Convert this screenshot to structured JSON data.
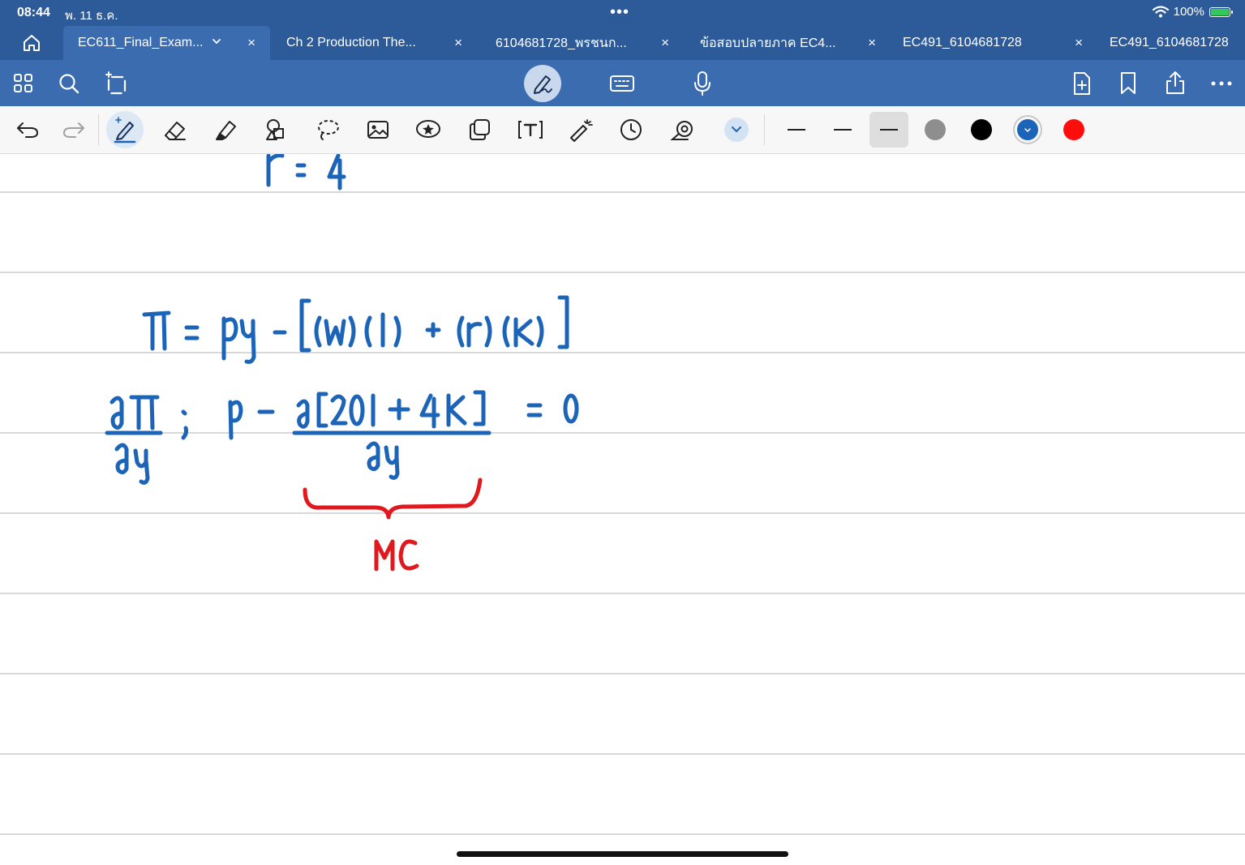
{
  "status_bar": {
    "time": "08:44",
    "date": "พ. 11 ธ.ค.",
    "battery_percent": "100%"
  },
  "tabs": [
    {
      "label": "EC611_Final_Exam...",
      "active": true
    },
    {
      "label": "Ch 2 Production The...",
      "active": false
    },
    {
      "label": "6104681728_พรชนก...",
      "active": false
    },
    {
      "label": "ข้อสอบปลายภาค EC4...",
      "active": false
    },
    {
      "label": "EC491_6104681728",
      "active": false
    },
    {
      "label": "EC491_6104681728",
      "active": false
    }
  ],
  "toolbar": {
    "selected_tool": "pen",
    "pen_colors": [
      "#8e8e8e",
      "#000000",
      "#1c64b8",
      "#ff0d0d"
    ],
    "selected_color": "#1c64b8",
    "selected_thickness": "thick"
  },
  "colors": {
    "header_dark": "#2d5b99",
    "header_light": "#3b6cb0",
    "ink_blue": "#1c64b8",
    "ink_red": "#e0191e",
    "ruled_line": "#d9d9d9"
  },
  "handwriting": {
    "line1": "r = 4",
    "line2": "π = py − [(w)(l) + (r)(k)]",
    "line3": "∂π/∂y ; p − ∂[20l + 4k]/∂y = 0",
    "annotation": "MC"
  }
}
